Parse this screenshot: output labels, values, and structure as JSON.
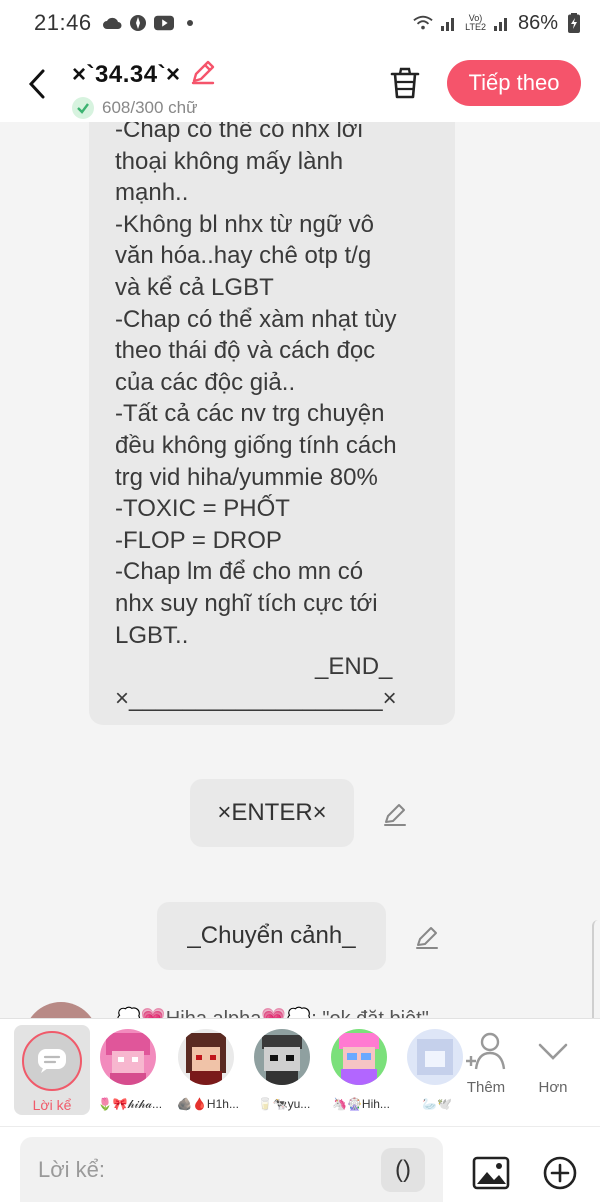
{
  "status_bar": {
    "time": "21:46",
    "lte_line1": "Vo)",
    "lte_line2": "LTE2",
    "battery": "86%"
  },
  "header": {
    "title": "×`34.34`×",
    "char_count": "608/300 chữ",
    "next_label": "Tiếp theo"
  },
  "story": {
    "lines": [
      "-Chap có thể có nhx lời",
      "thoại không mấy lành",
      "mạnh..",
      "-Không bl nhx từ ngữ vô",
      "văn hóa..hay chê otp t/g",
      "và kể cả LGBT",
      "-Chap có thể xàm nhạt tùy",
      "theo thái độ và cách đọc",
      "của các độc giả..",
      "-Tất cả các nv trg chuyện",
      "đều không giống tính cách",
      "trg vid hiha/yummie 80%",
      "-TOXIC = PHỐT",
      "-FLOP = DROP",
      "-Chap lm để cho mn có",
      "nhx suy nghĩ tích cực tới",
      "LGBT..",
      "_END_",
      "×___________________×"
    ],
    "enter_chip": "×ENTER×",
    "scene_chip": "_Chuyển cảnh_",
    "next_peek_text": "💭💗Hiha alpha💗💭: \"ok đặt biệt\""
  },
  "character_bar": {
    "narrator_label": "Lời kể",
    "characters": [
      {
        "name": "🌷🎀𝒽𝒾𝒽𝒶..."
      },
      {
        "name": "🪨🩸H1h..."
      },
      {
        "name": "🥛🐄yu..."
      },
      {
        "name": "🦄🎡Hih..."
      },
      {
        "name": "🦢🕊️"
      }
    ],
    "more_label": "Thêm",
    "less_label": "Hơn"
  },
  "input_bar": {
    "placeholder": "Lời kể:",
    "paren_label": "()"
  },
  "colors": {
    "accent": "#f5546b",
    "bubble": "#e9e9e9",
    "check": "#3cb371"
  }
}
